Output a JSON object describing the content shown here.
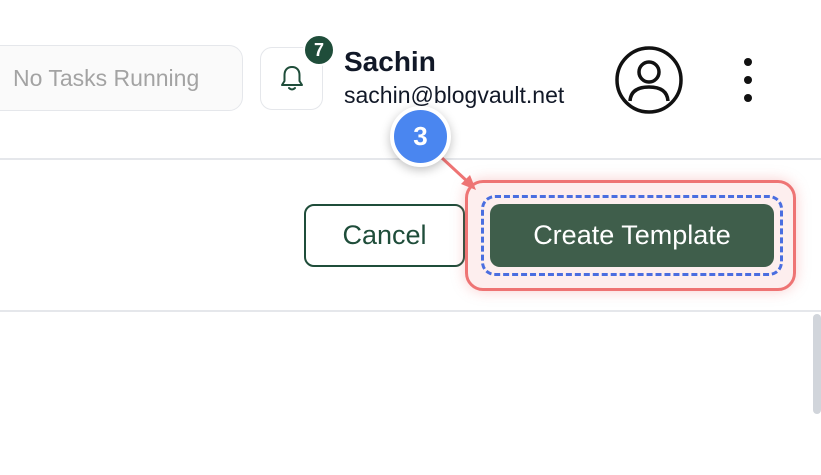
{
  "header": {
    "task_status": "No Tasks Running",
    "notifications": {
      "count": "7",
      "icon": "bell-icon"
    },
    "user": {
      "name": "Sachin",
      "email": "sachin@blogvault.net",
      "avatar_icon": "user-avatar-icon"
    },
    "menu_icon": "kebab-menu-icon"
  },
  "actions": {
    "cancel_label": "Cancel",
    "create_label": "Create Template"
  },
  "tutorial": {
    "step_number": "3",
    "highlight_color": "#ee7474",
    "badge_color": "#4a86f0"
  },
  "colors": {
    "brand_green": "#1f4d3a",
    "button_green": "#3f5e4b"
  }
}
